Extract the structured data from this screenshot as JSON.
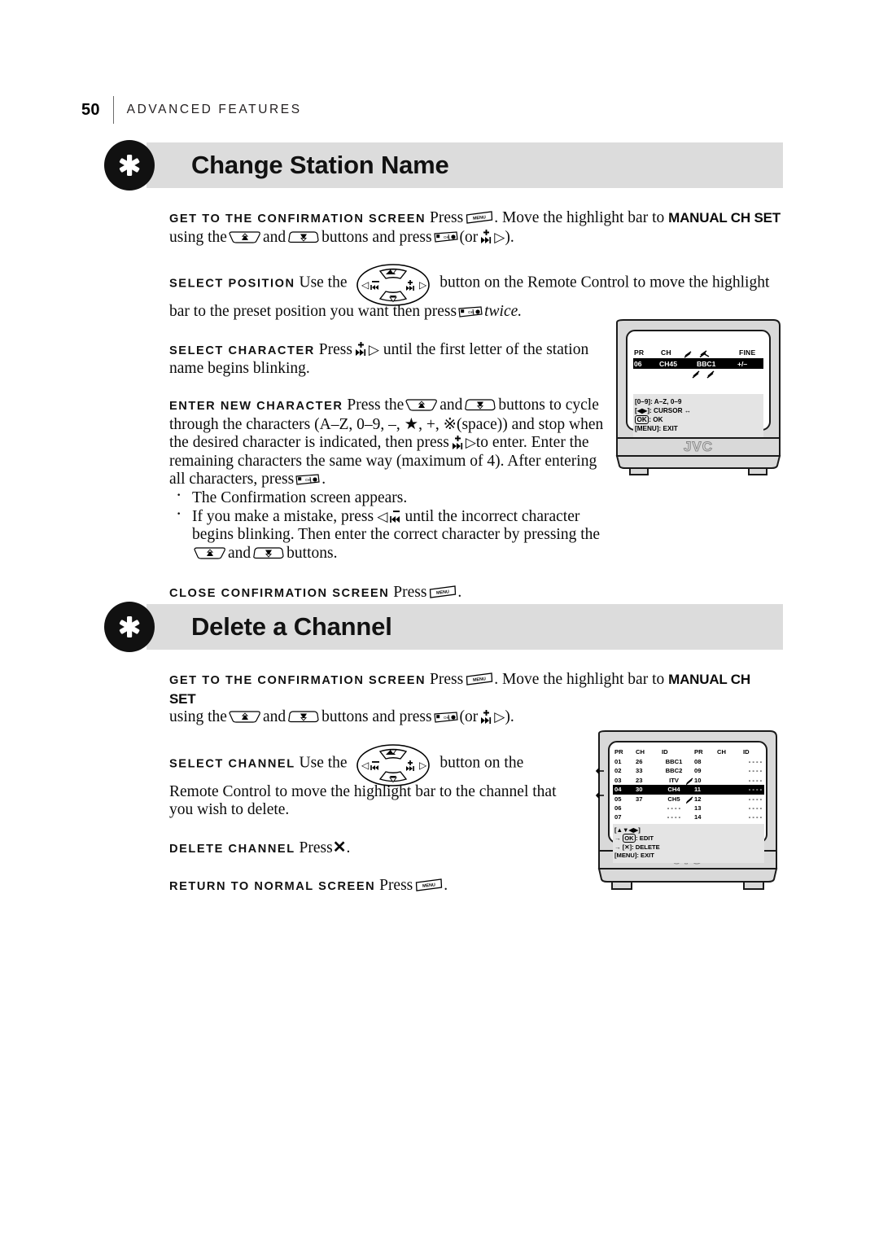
{
  "running_head": {
    "page_number": "50",
    "chapter": "ADVANCED FEATURES"
  },
  "sections": [
    {
      "id": "change-station-name",
      "title": "Change Station Name",
      "steps": [
        {
          "lead": "GET TO THE CONFIRMATION SCREEN",
          "text_1": "Press",
          "icon_1": "menu-button-icon",
          "text_2": ". Move the highlight bar to",
          "emphasis": "MANUAL CH SET",
          "text_3": "using the",
          "icon_2": "channel-up-button-icon",
          "text_4": "and",
          "icon_3": "channel-down-button-icon",
          "text_5": "buttons and press",
          "icon_4": "ok-record-button-icon",
          "text_6": "(or",
          "icon_5": "skip-forward-button-icon",
          "icon_6": "right-triangle-icon",
          "text_7": ")."
        },
        {
          "lead": "SELECT POSITION",
          "text_1": "Use the",
          "icon_1": "four-way-nav-button-icon",
          "text_2": "button on the Remote Control to move the highlight bar to the preset position you want then press",
          "icon_2": "ok-record-button-icon",
          "text_3": "twice."
        },
        {
          "lead": "SELECT CHARACTER",
          "text_1": "Press",
          "icon_1": "skip-forward-button-icon",
          "icon_2": "right-triangle-icon",
          "text_2": "until the first letter of the station name begins blinking."
        },
        {
          "lead": "ENTER NEW CHARACTER",
          "text_1": "Press the",
          "icon_1": "channel-up-button-icon",
          "text_2": "and",
          "icon_2": "channel-down-button-icon",
          "text_3": "buttons to cycle through the characters (A–Z, 0–9, –,",
          "star": "★",
          "text_4": ", +,",
          "space_glyph": "⌴",
          "text_5": "(space)) and stop when the desired character is indicated, then press",
          "icon_3": "skip-forward-button-icon",
          "icon_4": "right-triangle-icon",
          "text_6": "to enter. Enter the remaining characters the same way (maximum of 4). After entering all characters, press",
          "icon_5": "ok-record-button-icon",
          "text_7": ".",
          "bullets": [
            {
              "text_1": "The Confirmation screen appears."
            },
            {
              "text_1": "If you make a mistake, press",
              "icon_1": "left-triangle-icon",
              "icon_2": "skip-back-button-icon",
              "text_2": "until the incorrect character begins blinking. Then enter the correct character by pressing the",
              "icon_3": "channel-up-button-icon",
              "text_3": "and",
              "icon_4": "channel-down-button-icon",
              "text_4": "buttons."
            }
          ]
        },
        {
          "lead": "CLOSE CONFIRMATION SCREEN",
          "text_1": "Press",
          "icon_1": "menu-button-icon",
          "text_2": "."
        }
      ],
      "tv_screen": {
        "brand": "JVC",
        "osd_type": "station-name-edit",
        "table": {
          "headers": [
            "PR",
            "CH",
            "",
            "",
            "FINE"
          ],
          "row": [
            "06",
            "CH45",
            "BBC1",
            "+/–"
          ]
        },
        "legend": [
          "[0–9]:  A–Z, 0–9",
          "[◀▶]: CURSOR ↔",
          "OK : OK",
          "[MENU]: EXIT"
        ],
        "ok_key_label": "OK"
      }
    },
    {
      "id": "delete-a-channel",
      "title": "Delete a Channel",
      "steps": [
        {
          "lead": "GET TO THE CONFIRMATION SCREEN",
          "text_1": "Press",
          "icon_1": "menu-button-icon",
          "text_2": ". Move the highlight bar to",
          "emphasis": "MANUAL CH SET",
          "text_3": "using the",
          "icon_2": "channel-up-button-icon",
          "text_4": "and",
          "icon_3": "channel-down-button-icon",
          "text_5": "buttons and press",
          "icon_4": "ok-record-button-icon",
          "text_6": "(or",
          "icon_5": "skip-forward-button-icon",
          "icon_6": "right-triangle-icon",
          "text_7": ")."
        },
        {
          "lead": "SELECT CHANNEL",
          "text_1": "Use the",
          "icon_1": "four-way-nav-button-icon",
          "text_2": "button on the Remote Control to move the highlight bar to the channel that you wish to delete."
        },
        {
          "lead": "DELETE CHANNEL",
          "text_1": "Press",
          "icon_1": "x-delete-button-icon",
          "text_2": "."
        },
        {
          "lead": "RETURN TO NORMAL SCREEN",
          "text_1": "Press",
          "icon_1": "menu-button-icon",
          "text_2": "."
        }
      ],
      "tv_screen": {
        "brand": "JVC",
        "osd_type": "channel-list",
        "table": {
          "headers": [
            "PR",
            "CH",
            "ID",
            "PR",
            "CH",
            "ID"
          ],
          "rows": [
            {
              "pr_l": "01",
              "ch_l": "26",
              "id_l": "BBC1",
              "blink_l": false,
              "pr_r": "08",
              "ch_r": "",
              "id_r": "- - - -",
              "highlight": false
            },
            {
              "pr_l": "02",
              "ch_l": "33",
              "id_l": "BBC2",
              "blink_l": false,
              "pr_r": "09",
              "ch_r": "",
              "id_r": "- - - -",
              "highlight": false
            },
            {
              "pr_l": "03",
              "ch_l": "23",
              "id_l": "ITV",
              "blink_l": true,
              "pr_r": "10",
              "ch_r": "",
              "id_r": "- - - -",
              "highlight": false
            },
            {
              "pr_l": "04",
              "ch_l": "30",
              "id_l": "CH4",
              "blink_l": false,
              "pr_r": "11",
              "ch_r": "",
              "id_r": "- - - -",
              "highlight": true
            },
            {
              "pr_l": "05",
              "ch_l": "37",
              "id_l": "CH5",
              "blink_l": true,
              "pr_r": "12",
              "ch_r": "",
              "id_r": "- - - -",
              "highlight": false
            },
            {
              "pr_l": "06",
              "ch_l": "",
              "id_l": "- - - -",
              "blink_l": false,
              "pr_r": "13",
              "ch_r": "",
              "id_r": "- - - -",
              "highlight": false
            },
            {
              "pr_l": "07",
              "ch_l": "",
              "id_l": "- - - -",
              "blink_l": false,
              "pr_r": "14",
              "ch_r": "",
              "id_r": "- - - -",
              "highlight": false
            }
          ]
        },
        "legend": [
          "[▲▼◀▶]",
          "→ OK : EDIT",
          "→ [✕]: DELETE",
          "[MENU]: EXIT"
        ]
      }
    }
  ],
  "colors": {
    "banner_bg": "#dcdcdc",
    "badge": "#111111",
    "tv_body": "#d9d9d9",
    "tv_screen": "#ffffff",
    "osd_panel": "#e4e4e4",
    "highlight": "#000000",
    "rule": "#6d6d6d"
  }
}
